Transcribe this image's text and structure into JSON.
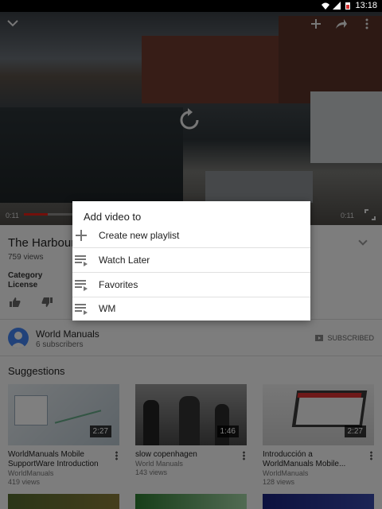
{
  "statusbar": {
    "time": "13:18"
  },
  "player": {
    "elapsed": "0:11",
    "duration": "0:11",
    "progress": 0.15
  },
  "video": {
    "title": "The Harbour",
    "views": "759 views",
    "category_label": "Category",
    "license_label": "License"
  },
  "channel": {
    "name": "World Manuals",
    "subscribers": "6 subscribers",
    "subscribed_label": "SUBSCRIBED"
  },
  "suggestions": {
    "heading": "Suggestions",
    "items": [
      {
        "title": "WorldManuals Mobile SupportWare Introduction",
        "channel": "WorldManuals",
        "views": "419 views",
        "duration": "2:27"
      },
      {
        "title": "slow copenhagen",
        "channel": "World Manuals",
        "views": "143 views",
        "duration": "1:46"
      },
      {
        "title": "Introducción a WorldManuals Mobile...",
        "channel": "WorldManuals",
        "views": "128 views",
        "duration": "2:27"
      }
    ]
  },
  "dialog": {
    "title": "Add video to",
    "items": [
      {
        "label": "Create new playlist",
        "icon": "plus-icon"
      },
      {
        "label": "Watch Later",
        "icon": "playlist-icon"
      },
      {
        "label": "Favorites",
        "icon": "playlist-icon"
      },
      {
        "label": "WM",
        "icon": "playlist-icon"
      }
    ]
  },
  "colors": {
    "accent": "#e62117",
    "avatar": "#4285f4"
  }
}
